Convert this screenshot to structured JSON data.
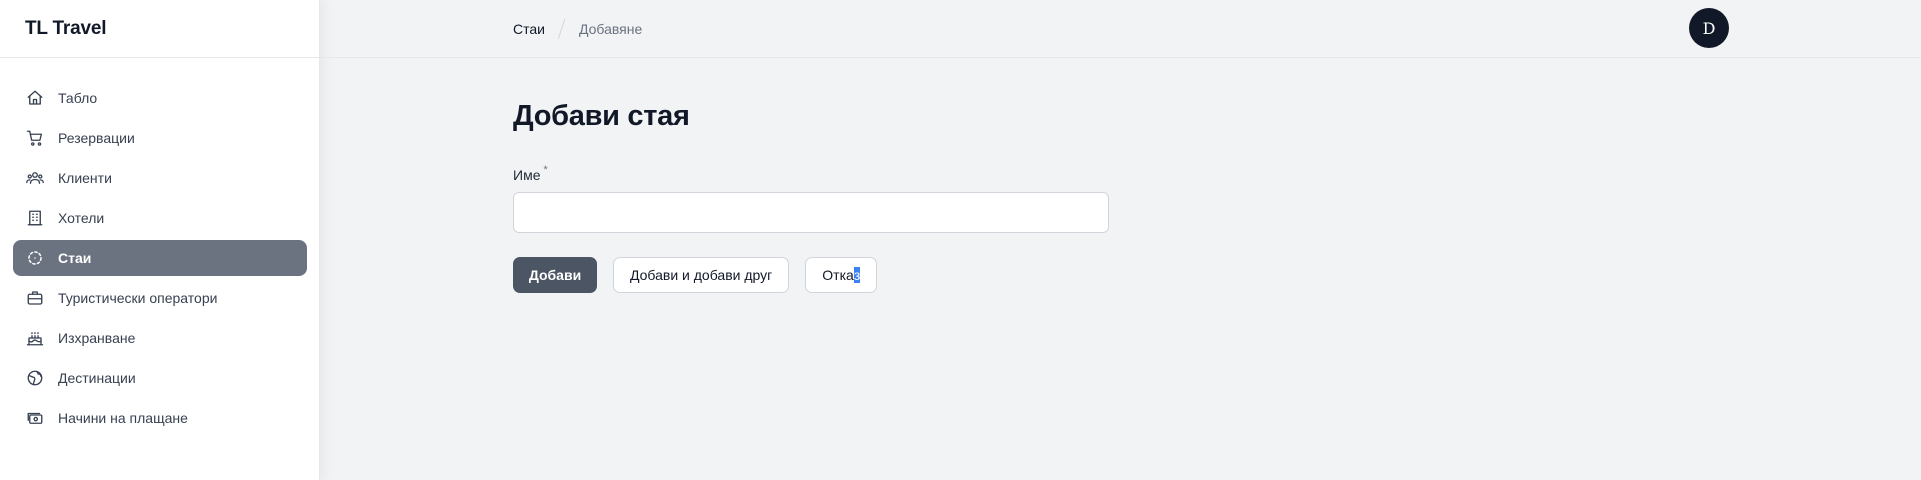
{
  "app": {
    "brand": "TL Travel"
  },
  "sidebar": {
    "items": [
      {
        "label": "Табло",
        "icon": "home-icon"
      },
      {
        "label": "Резервации",
        "icon": "cart-icon"
      },
      {
        "label": "Клиенти",
        "icon": "users-icon"
      },
      {
        "label": "Хотели",
        "icon": "building-icon"
      },
      {
        "label": "Стаи",
        "icon": "dashed-circle-icon",
        "active": true
      },
      {
        "label": "Туристически оператори",
        "icon": "briefcase-icon"
      },
      {
        "label": "Изхранване",
        "icon": "cake-icon"
      },
      {
        "label": "Дестинации",
        "icon": "globe-icon"
      },
      {
        "label": "Начини на плащане",
        "icon": "cash-icon"
      }
    ]
  },
  "header": {
    "breadcrumb": [
      "Стаи",
      "Добавяне"
    ],
    "avatar_initial": "D"
  },
  "main": {
    "title": "Добави стая",
    "form": {
      "name_label": "Име",
      "required_mark": "*",
      "name_value": ""
    },
    "buttons": {
      "create": "Добави",
      "create_another": "Добави и добави друг",
      "cancel_plain": "Отка",
      "cancel_selected": "з"
    }
  },
  "colors": {
    "active_nav": "#6b7280",
    "primary_button": "#4b5563",
    "background": "#f2f3f5",
    "avatar": "#111827",
    "text_selection": "#3b82f6"
  }
}
